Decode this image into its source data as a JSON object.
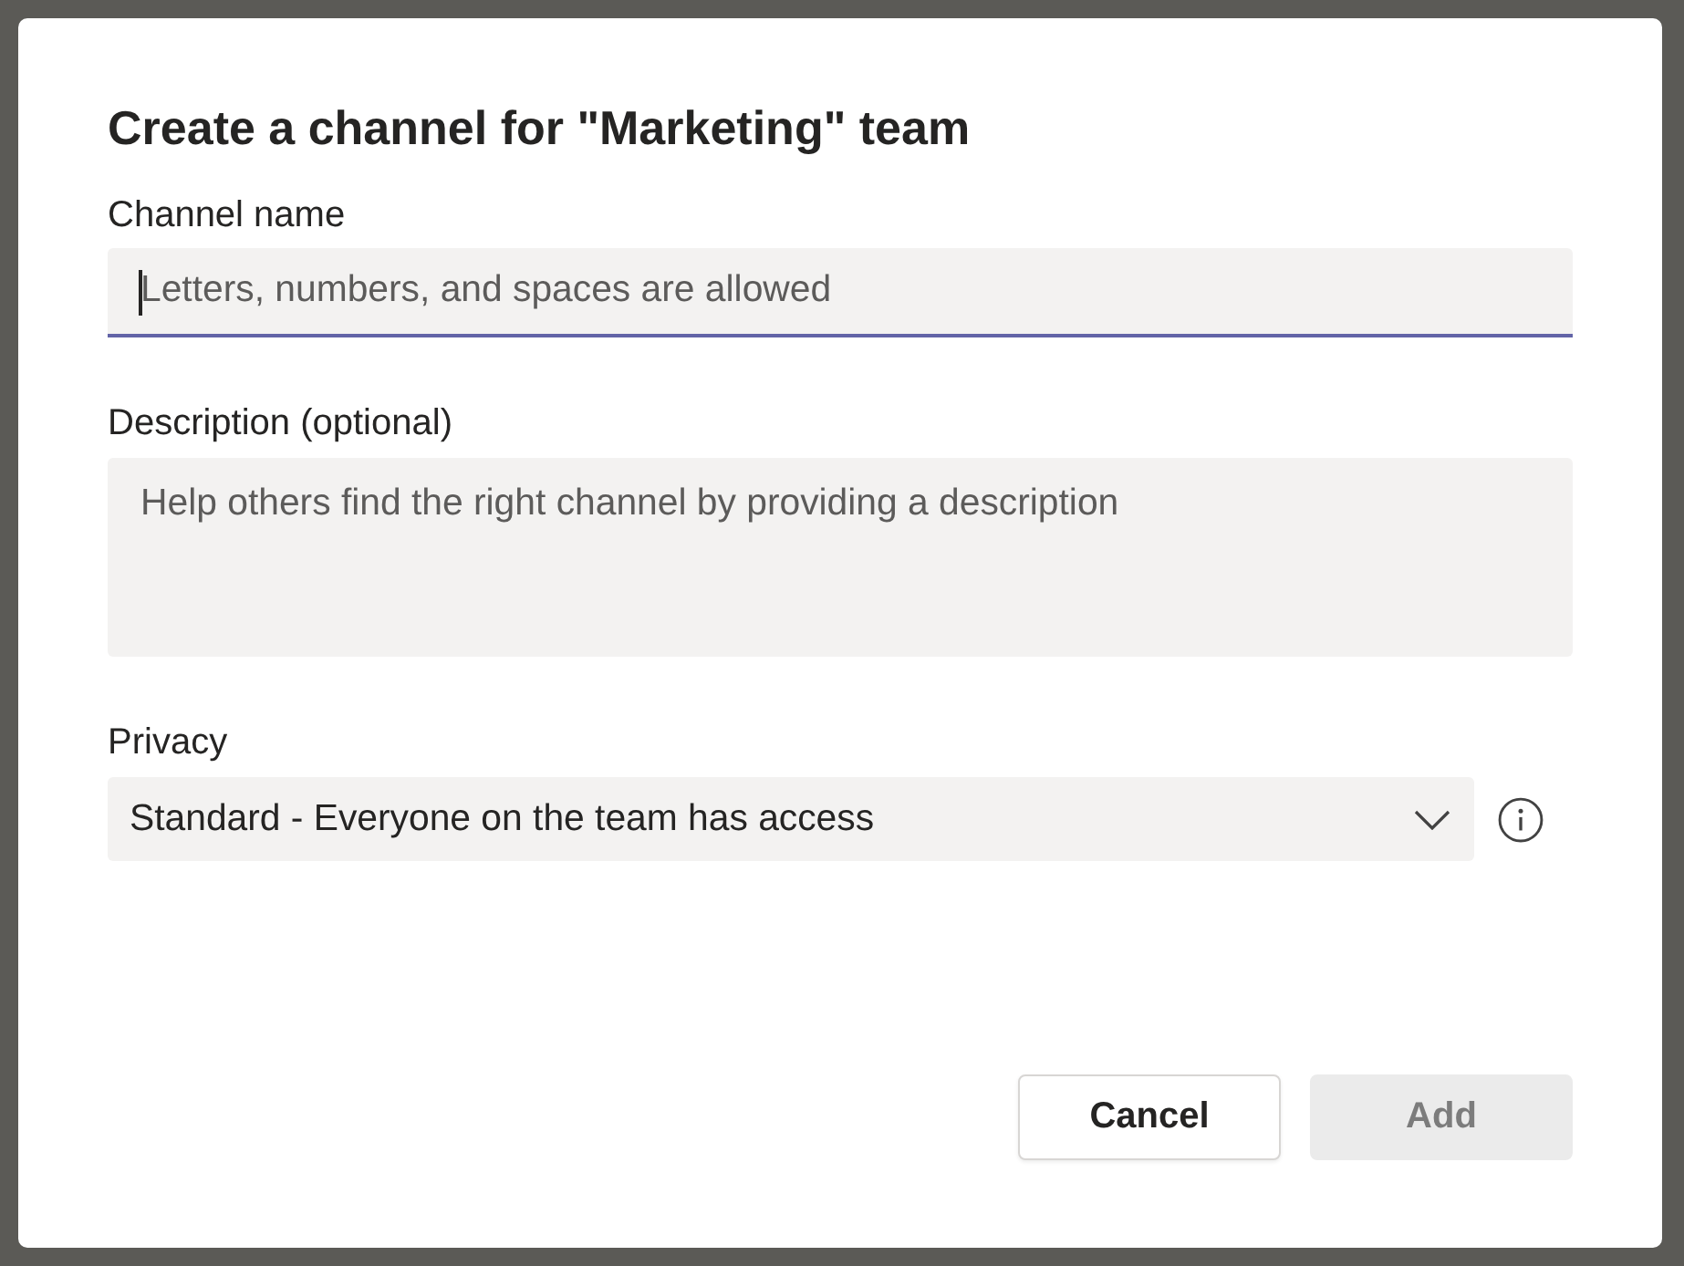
{
  "dialog": {
    "title": "Create a channel for \"Marketing\" team",
    "fields": [
      {
        "kind": "text",
        "label": "Channel name",
        "placeholder": "Letters, numbers, and spaces are allowed",
        "focused": true
      },
      {
        "kind": "textarea",
        "label": "Description (optional)",
        "placeholder": "Help others find the right channel by providing a description",
        "focused": false
      },
      {
        "kind": "select",
        "label": "Privacy",
        "value": "Standard - Everyone on the team has access"
      }
    ],
    "buttons": [
      {
        "label": "Cancel",
        "disabled": false
      },
      {
        "label": "Add",
        "disabled": true
      }
    ]
  }
}
